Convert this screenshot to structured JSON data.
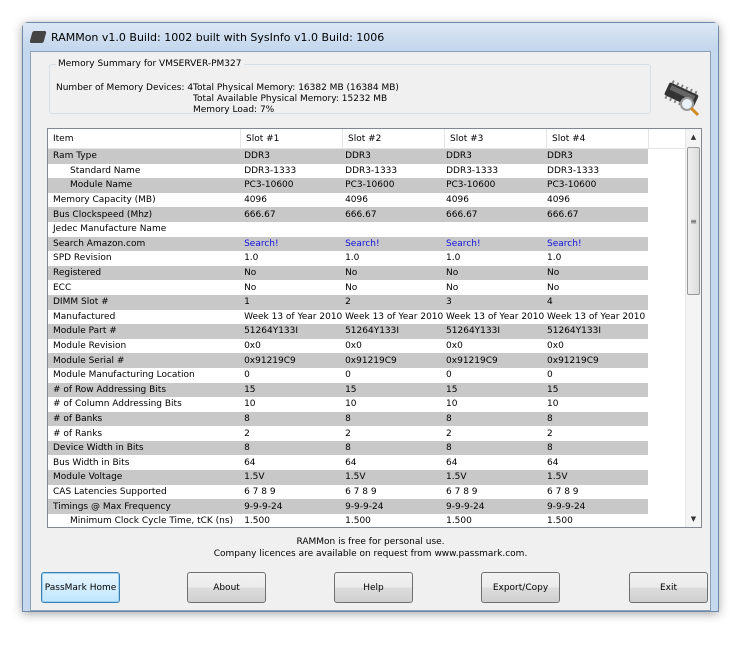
{
  "window": {
    "title": "RAMMon v1.0 Build: 1002 built with SysInfo v1.0 Build: 1006"
  },
  "summary": {
    "legend": "Memory Summary for VMSERVER-PM327",
    "devices": "Number of Memory Devices: 4",
    "total_physical": "Total Physical Memory: 16382 MB (16384 MB)",
    "total_available": "Total Available Physical Memory: 15232 MB",
    "memory_load": "Memory Load: 7%"
  },
  "table": {
    "headers": [
      "Item",
      "Slot #1",
      "Slot #2",
      "Slot #3",
      "Slot #4"
    ],
    "rows": [
      {
        "label": "Ram Type",
        "indent": false,
        "values": [
          "DDR3",
          "DDR3",
          "DDR3",
          "DDR3"
        ]
      },
      {
        "label": "Standard Name",
        "indent": true,
        "values": [
          "DDR3-1333",
          "DDR3-1333",
          "DDR3-1333",
          "DDR3-1333"
        ]
      },
      {
        "label": "Module Name",
        "indent": true,
        "values": [
          "PC3-10600",
          "PC3-10600",
          "PC3-10600",
          "PC3-10600"
        ]
      },
      {
        "label": "Memory Capacity (MB)",
        "indent": false,
        "values": [
          "4096",
          "4096",
          "4096",
          "4096"
        ]
      },
      {
        "label": "Bus Clockspeed (Mhz)",
        "indent": false,
        "values": [
          "666.67",
          "666.67",
          "666.67",
          "666.67"
        ]
      },
      {
        "label": "Jedec Manufacture Name",
        "indent": false,
        "values": [
          "",
          "",
          "",
          ""
        ]
      },
      {
        "label": "Search Amazon.com",
        "indent": false,
        "link": true,
        "values": [
          "Search!",
          "Search!",
          "Search!",
          "Search!"
        ]
      },
      {
        "label": "SPD Revision",
        "indent": false,
        "values": [
          "1.0",
          "1.0",
          "1.0",
          "1.0"
        ]
      },
      {
        "label": "Registered",
        "indent": false,
        "values": [
          "No",
          "No",
          "No",
          "No"
        ]
      },
      {
        "label": "ECC",
        "indent": false,
        "values": [
          "No",
          "No",
          "No",
          "No"
        ]
      },
      {
        "label": "DIMM Slot #",
        "indent": false,
        "values": [
          "1",
          "2",
          "3",
          "4"
        ]
      },
      {
        "label": "Manufactured",
        "indent": false,
        "values": [
          "Week 13 of Year 2010",
          "Week 13 of Year 2010",
          "Week 13 of Year 2010",
          "Week 13 of Year 2010"
        ]
      },
      {
        "label": "Module Part #",
        "indent": false,
        "values": [
          "51264Y133I",
          "51264Y133I",
          "51264Y133I",
          "51264Y133I"
        ]
      },
      {
        "label": "Module Revision",
        "indent": false,
        "values": [
          "0x0",
          "0x0",
          "0x0",
          "0x0"
        ]
      },
      {
        "label": "Module Serial #",
        "indent": false,
        "values": [
          "0x91219C9",
          "0x91219C9",
          "0x91219C9",
          "0x91219C9"
        ]
      },
      {
        "label": "Module Manufacturing Location",
        "indent": false,
        "values": [
          "0",
          "0",
          "0",
          "0"
        ]
      },
      {
        "label": "# of Row Addressing Bits",
        "indent": false,
        "values": [
          "15",
          "15",
          "15",
          "15"
        ]
      },
      {
        "label": "# of Column Addressing Bits",
        "indent": false,
        "values": [
          "10",
          "10",
          "10",
          "10"
        ]
      },
      {
        "label": "# of Banks",
        "indent": false,
        "values": [
          "8",
          "8",
          "8",
          "8"
        ]
      },
      {
        "label": "# of Ranks",
        "indent": false,
        "values": [
          "2",
          "2",
          "2",
          "2"
        ]
      },
      {
        "label": "Device Width in Bits",
        "indent": false,
        "values": [
          "8",
          "8",
          "8",
          "8"
        ]
      },
      {
        "label": "Bus Width in Bits",
        "indent": false,
        "values": [
          "64",
          "64",
          "64",
          "64"
        ]
      },
      {
        "label": "Module Voltage",
        "indent": false,
        "values": [
          "1.5V",
          "1.5V",
          "1.5V",
          "1.5V"
        ]
      },
      {
        "label": "CAS Latencies Supported",
        "indent": false,
        "values": [
          "6 7 8 9",
          "6 7 8 9",
          "6 7 8 9",
          "6 7 8 9"
        ]
      },
      {
        "label": "Timings @ Max Frequency",
        "indent": false,
        "values": [
          "9-9-9-24",
          "9-9-9-24",
          "9-9-9-24",
          "9-9-9-24"
        ]
      },
      {
        "label": "Minimum Clock Cycle Time, tCK (ns)",
        "indent": true,
        "values": [
          "1.500",
          "1.500",
          "1.500",
          "1.500"
        ]
      }
    ]
  },
  "footer": {
    "line1": "RAMMon is free for personal use.",
    "line2": "Company licences are available on request from www.passmark.com."
  },
  "buttons": {
    "passmark": "PassMark Home",
    "about": "About",
    "help": "Help",
    "export": "Export/Copy",
    "exit": "Exit"
  },
  "colors": {
    "stripe": "#c8c8c8",
    "link": "#1010e0",
    "default_button": "#bee6fd"
  }
}
